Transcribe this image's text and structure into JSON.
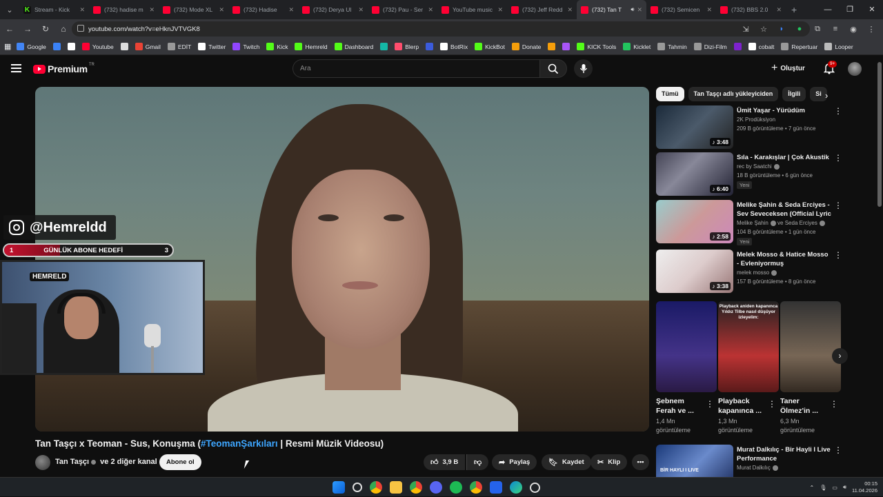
{
  "browser": {
    "tabs": [
      {
        "label": "Stream - Kick",
        "favicon": "kick"
      },
      {
        "label": "(732) hadise m",
        "favicon": "yt"
      },
      {
        "label": "(732) Mode XL",
        "favicon": "yt"
      },
      {
        "label": "(732) Hadise",
        "favicon": "yt"
      },
      {
        "label": "(732) Derya Ul",
        "favicon": "yt"
      },
      {
        "label": "(732) Pau - Ser",
        "favicon": "yt"
      },
      {
        "label": "YouTube music",
        "favicon": "yt"
      },
      {
        "label": "(732) Jeff Redd",
        "favicon": "yt"
      },
      {
        "label": "(732) Tan T",
        "favicon": "yt",
        "active": true
      },
      {
        "label": "(732) Semicen",
        "favicon": "yt"
      },
      {
        "label": "(732) BBS 2.0",
        "favicon": "yt"
      }
    ],
    "url": "youtube.com/watch?v=eHknJVTVGK8",
    "bookmarks": [
      {
        "label": "Google",
        "color": "#4285f4"
      },
      {
        "label": "",
        "color": "#3b82f6"
      },
      {
        "label": "",
        "color": "#ffffff"
      },
      {
        "label": "Youtube",
        "color": "#ff0033"
      },
      {
        "label": "",
        "color": "#dddddd"
      },
      {
        "label": "Gmail",
        "color": "#ea4335"
      },
      {
        "label": "EDİT",
        "color": "#999999"
      },
      {
        "label": "Twitter",
        "color": "#ffffff"
      },
      {
        "label": "Twitch",
        "color": "#9146ff"
      },
      {
        "label": "Kick",
        "color": "#53fc18"
      },
      {
        "label": "Hemreld",
        "color": "#53fc18"
      },
      {
        "label": "Dashboard",
        "color": "#53fc18"
      },
      {
        "label": "",
        "color": "#14b8a6"
      },
      {
        "label": "Blerp",
        "color": "#ff4d6d"
      },
      {
        "label": "",
        "color": "#3b5bdb"
      },
      {
        "label": "BotRix",
        "color": "#ffffff"
      },
      {
        "label": "KickBot",
        "color": "#53fc18"
      },
      {
        "label": "Donate",
        "color": "#f59e0b"
      },
      {
        "label": "",
        "color": "#f59e0b"
      },
      {
        "label": "",
        "color": "#a855f7"
      },
      {
        "label": "KICK Tools",
        "color": "#53fc18"
      },
      {
        "label": "Kicklet",
        "color": "#22c55e"
      },
      {
        "label": "Tahmin",
        "color": "#999999"
      },
      {
        "label": "Dizi-Film",
        "color": "#999999"
      },
      {
        "label": "",
        "color": "#7e22ce"
      },
      {
        "label": "cobalt",
        "color": "#ffffff"
      },
      {
        "label": "Repertuar",
        "color": "#999999"
      },
      {
        "label": "Looper",
        "color": "#bbbbbb"
      }
    ]
  },
  "header": {
    "logo_text": "Premium",
    "logo_region": "TR",
    "search_placeholder": "Ara",
    "create_label": "Oluştur",
    "notif_badge": "9+"
  },
  "overlay": {
    "handle": "@Hemreldd",
    "goal_left": "1",
    "goal_label": "GÜNLÜK ABONE HEDEFİ",
    "goal_right": "3",
    "goal_progress": 0.33,
    "cam_sign": "HEMRELD"
  },
  "video": {
    "title_part1": "Tan Taşçı x Teoman - Sus, Konuşma (",
    "title_tag": "#TeomanŞarkıları",
    "title_part2": " | Resmi Müzik Videosu)",
    "channel": "Tan Taşçı",
    "channel_extra": " ve 2 diğer kanal",
    "subscribe_label": "Abone ol",
    "likes": "3,9 B",
    "share_label": "Paylaş",
    "save_label": "Kaydet",
    "clip_label": "Klip"
  },
  "chips": [
    "Tümü",
    "Tan Taşçı adlı yükleyiciden",
    "İlgili",
    "Si"
  ],
  "recommendations": [
    {
      "title": "Ümit Yaşar - Yürüdüm",
      "channel": "2K Prodüksiyon",
      "verified": false,
      "stats": "209 B görüntüleme • 7 gün önce",
      "duration": "3:48",
      "new": "",
      "thumb": "linear-gradient(135deg,#1b2a3a,#4b5a6a 50%,#222)"
    },
    {
      "title": "Sıla - Karakışlar | Çok Akustik",
      "channel": "rec by Saatchi",
      "verified": true,
      "stats": "18 B görüntüleme • 6 gün önce",
      "duration": "6:40",
      "new": "Yeni",
      "thumb": "linear-gradient(135deg,#445,#889 40%,#223)"
    },
    {
      "title": "Melike Şahin & Seda Erciyes - Sev Seveceksen (Official Lyric ...",
      "channel": "Melike Şahin",
      "channel_extra": "ve Seda Erciyes",
      "verified": true,
      "stats": "104 B görüntüleme • 1 gün önce",
      "duration": "2:58",
      "new": "Yeni",
      "thumb": "linear-gradient(135deg,#9cc,#c99 50%,#c8b)"
    },
    {
      "title": "Melek Mosso & Hatice Mosso - Evleniyormuş",
      "channel": "melek mosso",
      "verified": true,
      "stats": "157 B görüntüleme • 8 gün önce",
      "duration": "3:38",
      "new": "",
      "thumb": "linear-gradient(135deg,#eee,#dcc 50%,#977)"
    }
  ],
  "shorts": [
    {
      "title": "Şebnem Ferah ve ...",
      "views": "1,4 Mn görüntüleme",
      "caption": "",
      "thumb": "linear-gradient(180deg,#1a1a66,#443388 60%,#2a1a44)"
    },
    {
      "title": "Playback kapanınca ...",
      "views": "1,3 Mn görüntüleme",
      "caption": "Playback aniden kapanınca Yıldız Tilbe nasıl düşüyor izleyelim:",
      "thumb": "linear-gradient(180deg,#222,#b33 60%,#5a1a1a)"
    },
    {
      "title": "Taner Ölmez'in ...",
      "views": "6,3 Mn görüntüleme",
      "caption": "",
      "thumb": "linear-gradient(180deg,#333,#776655 60%,#332a22)"
    }
  ],
  "rec_bottom": {
    "title": "Murat Dalkılıç - Bir Hayli I Live Performance",
    "channel": "Murat Dalkılıç",
    "thumb_caption": "BİR HAYLI I LIVE"
  },
  "taskbar": {
    "time": "00:15",
    "date": "11.04.2026"
  }
}
